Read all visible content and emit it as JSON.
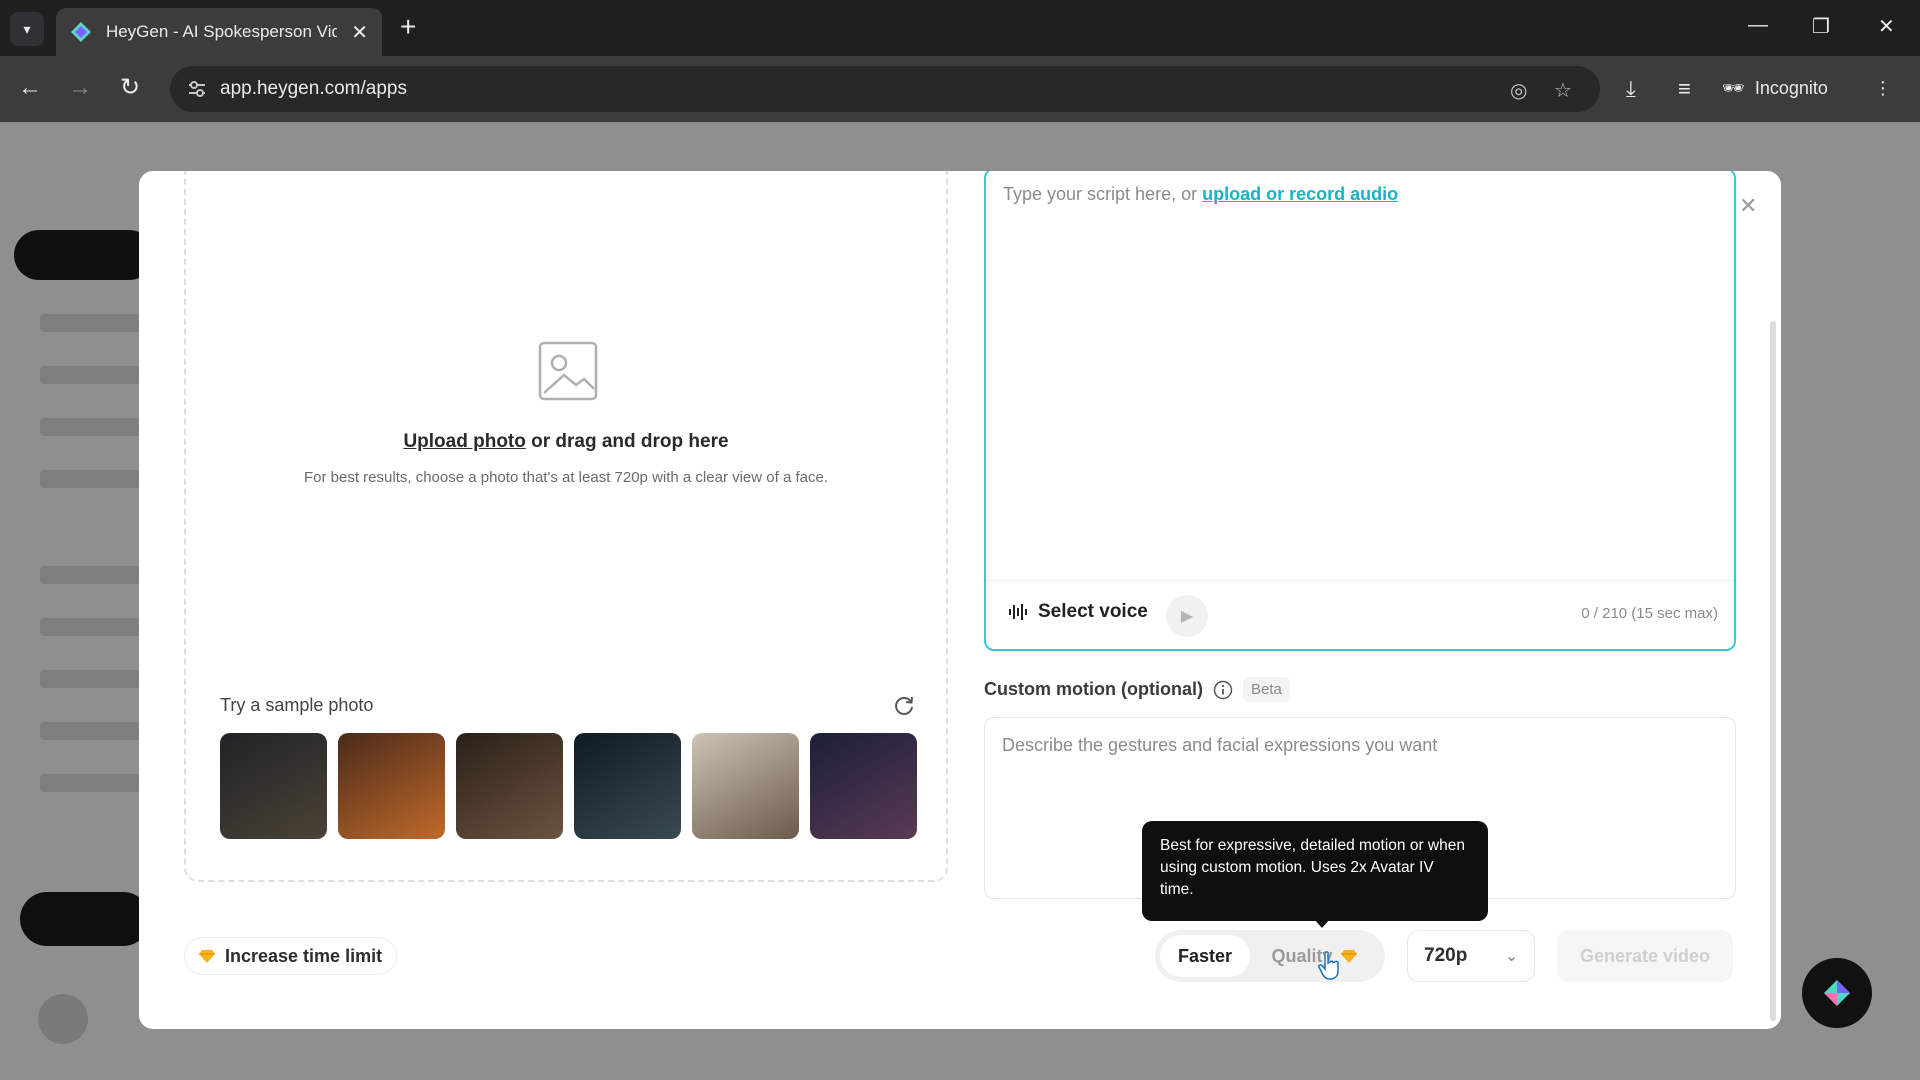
{
  "browser": {
    "tab_title": "HeyGen - AI Spokesperson Video",
    "new_tab_label": "+",
    "url": "app.heygen.com/apps",
    "incognito_label": "Incognito",
    "tab_search_icon": "chevron-down-icon",
    "window_controls": {
      "minimize": "—",
      "restore": "❐",
      "close": "✕"
    }
  },
  "modal": {
    "close_icon": "✕",
    "upload": {
      "link_text": "Upload photo",
      "rest_text": " or drag and drop here",
      "hint": "For best results, choose a photo that's at least 720p with a clear view of a face.",
      "sample_title": "Try a sample photo",
      "samples": [
        {
          "name": "sample-photo-1",
          "colors": [
            "#1f2326",
            "#4b4236"
          ]
        },
        {
          "name": "sample-photo-2",
          "colors": [
            "#4a2a1a",
            "#c06a2a"
          ]
        },
        {
          "name": "sample-photo-3",
          "colors": [
            "#2a2016",
            "#6b5340"
          ]
        },
        {
          "name": "sample-photo-4",
          "colors": [
            "#0f1a22",
            "#3a4a52"
          ]
        },
        {
          "name": "sample-photo-5",
          "colors": [
            "#cfc3b6",
            "#6a5a4a"
          ]
        },
        {
          "name": "sample-photo-6",
          "colors": [
            "#1a1f35",
            "#5a3a55"
          ]
        }
      ]
    },
    "script": {
      "placeholder": "Type your script here, or ",
      "link": "upload or record audio",
      "select_voice": "Select voice",
      "char_count": "0 / 210 (15 sec max)"
    },
    "motion": {
      "label": "Custom motion (optional)",
      "beta": "Beta",
      "placeholder": "Describe the gestures and facial expressions you want"
    },
    "tooltip": "Best for expressive, detailed motion or when using custom motion. Uses 2x Avatar IV time.",
    "footer": {
      "increase_time": "Increase time limit",
      "faster": "Faster",
      "quality": "Quality",
      "resolution": "720p",
      "generate": "Generate video"
    }
  },
  "colors": {
    "accent": "#3cc6d2",
    "link": "#17b3c7",
    "gem": "#f5b21e"
  }
}
